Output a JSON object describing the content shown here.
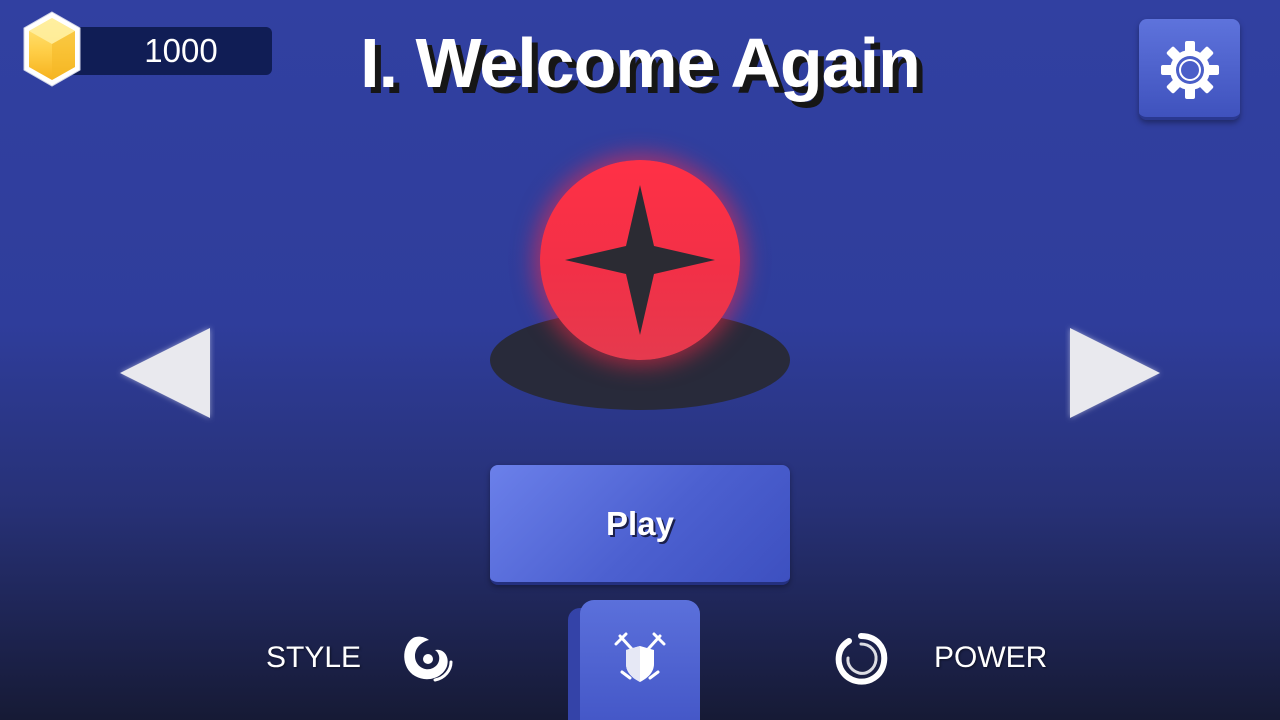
{
  "hud": {
    "coins": "1000",
    "coin_icon": "gold-hexagon-coin-icon"
  },
  "level": {
    "title": "I. Welcome Again"
  },
  "settings": {
    "icon": "gear-icon"
  },
  "hero": {
    "ball_color": "#ff3046",
    "emblem": "four-point-star-shuriken-icon"
  },
  "navigation": {
    "prev_icon": "left-triangle-arrow-icon",
    "next_icon": "right-triangle-arrow-icon"
  },
  "play_button": {
    "label": "Play"
  },
  "bottom_nav": {
    "style_label": "STYLE",
    "style_icon": "swirl-icon",
    "battle_icon": "crossed-swords-shield-icon",
    "power_label": "POWER",
    "power_icon": "ring-icon"
  },
  "colors": {
    "background": "#3140a1",
    "button": "#5a6fdc",
    "coin_bar": "#101d55",
    "title_shadow": "#161616"
  }
}
